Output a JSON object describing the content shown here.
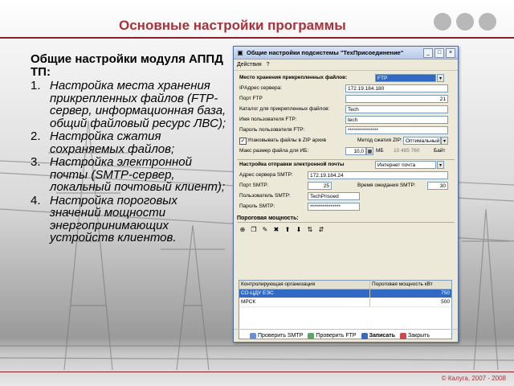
{
  "slide": {
    "title": "Основные настройки программы",
    "copyright": "© Калуга, 2007 - 2008",
    "accent_color": "#a8323b"
  },
  "left_panel": {
    "heading": "Общие настройки модуля АППД ТП:",
    "items": [
      {
        "num": "1.",
        "text": "Настройка места хранения прикрепленных файлов (FTP-сервер, информационная база, общий файловый ресурс ЛВС);"
      },
      {
        "num": "2.",
        "text": "Настройка сжатия сохраняемых файлов;"
      },
      {
        "num": "3.",
        "text": "Настройка электронной почты (SMTP-сервер, локальный почтовый клиент);"
      },
      {
        "num": "4.",
        "text": "Настройка пороговых значений мощности энергопринимающих устройств клиентов."
      }
    ]
  },
  "dialog": {
    "title": "Общие настройки подсистемы \"ТехПрисоединение\"",
    "menu": {
      "actions": "Действия",
      "help": "?"
    },
    "storage": {
      "label": "Место хранения прикрепленных файлов:",
      "value": "FTP",
      "ip_label": "IPАдрес сервера:",
      "ip_value": "172.19.184.180",
      "port_label": "Порт FTP",
      "port_value": "21",
      "catalog_label": "Каталог для прикрепленных файлов:",
      "catalog_value": "Tech",
      "user_label": "Имя пользователя FTP:",
      "user_value": "tech",
      "pass_label": "Пароль пользователя FTP:",
      "pass_value": "***************",
      "zip_label": "Упаковывать файлы в ZIP архив",
      "zip_method_label": "Метод сжатия ZIP:",
      "zip_method_value": "Оптимальный",
      "maxsize_label": "Макс размер файла для ИБ:",
      "maxsize_value": "10,0",
      "maxsize_unit": "МБ",
      "maxsize_bytes": "10 485 760",
      "bytes_unit": "Байт"
    },
    "email": {
      "label": "Настройка отправки электронной почты",
      "value": "Интернет почта",
      "smtp_label": "Адрес сервера SMTP:",
      "smtp_value": "172.19.184.24",
      "port_label": "Порт SMTP:",
      "port_value": "25",
      "wait_label": "Время ожидания SMTP:",
      "wait_value": "30",
      "user_label": "Пользователь SMTP:",
      "user_value": "TechPrisoed",
      "pass_label": "Пароль SMTP:",
      "pass_value": "***************"
    },
    "threshold": {
      "label": "Пороговая мощность:",
      "col1": "Контролирующая организация",
      "col2": "Пороговая мощность кВт",
      "rows": [
        {
          "org": "СО-ЦДУ ЕЭС",
          "power": "750"
        },
        {
          "org": "МРСК",
          "power": "500"
        }
      ]
    },
    "footer": {
      "check_smtp": "Проверить SMTP",
      "check_ftp": "Проверить FTP",
      "save": "Записать",
      "close": "Закрыть"
    }
  }
}
